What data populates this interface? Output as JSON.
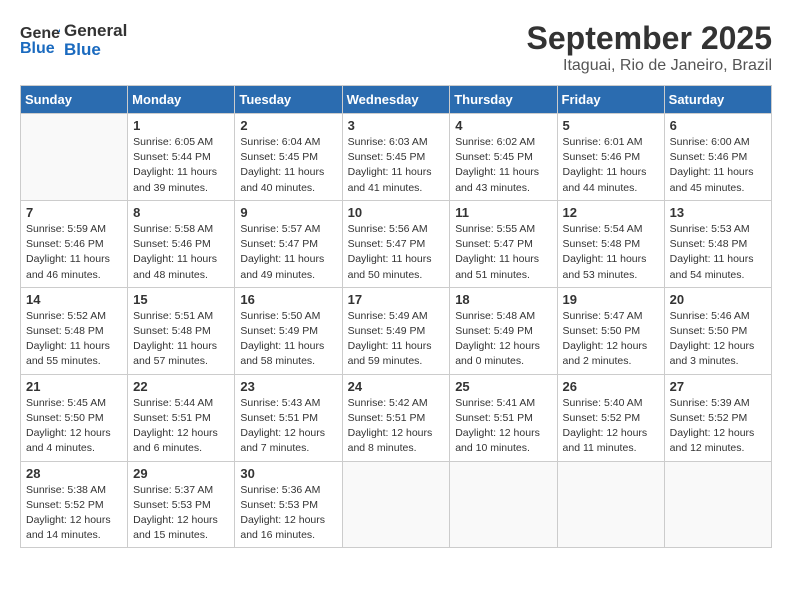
{
  "header": {
    "logo_general": "General",
    "logo_blue": "Blue",
    "title": "September 2025",
    "subtitle": "Itaguai, Rio de Janeiro, Brazil"
  },
  "weekdays": [
    "Sunday",
    "Monday",
    "Tuesday",
    "Wednesday",
    "Thursday",
    "Friday",
    "Saturday"
  ],
  "weeks": [
    [
      {
        "day": "",
        "info": ""
      },
      {
        "day": "1",
        "info": "Sunrise: 6:05 AM\nSunset: 5:44 PM\nDaylight: 11 hours\nand 39 minutes."
      },
      {
        "day": "2",
        "info": "Sunrise: 6:04 AM\nSunset: 5:45 PM\nDaylight: 11 hours\nand 40 minutes."
      },
      {
        "day": "3",
        "info": "Sunrise: 6:03 AM\nSunset: 5:45 PM\nDaylight: 11 hours\nand 41 minutes."
      },
      {
        "day": "4",
        "info": "Sunrise: 6:02 AM\nSunset: 5:45 PM\nDaylight: 11 hours\nand 43 minutes."
      },
      {
        "day": "5",
        "info": "Sunrise: 6:01 AM\nSunset: 5:46 PM\nDaylight: 11 hours\nand 44 minutes."
      },
      {
        "day": "6",
        "info": "Sunrise: 6:00 AM\nSunset: 5:46 PM\nDaylight: 11 hours\nand 45 minutes."
      }
    ],
    [
      {
        "day": "7",
        "info": "Sunrise: 5:59 AM\nSunset: 5:46 PM\nDaylight: 11 hours\nand 46 minutes."
      },
      {
        "day": "8",
        "info": "Sunrise: 5:58 AM\nSunset: 5:46 PM\nDaylight: 11 hours\nand 48 minutes."
      },
      {
        "day": "9",
        "info": "Sunrise: 5:57 AM\nSunset: 5:47 PM\nDaylight: 11 hours\nand 49 minutes."
      },
      {
        "day": "10",
        "info": "Sunrise: 5:56 AM\nSunset: 5:47 PM\nDaylight: 11 hours\nand 50 minutes."
      },
      {
        "day": "11",
        "info": "Sunrise: 5:55 AM\nSunset: 5:47 PM\nDaylight: 11 hours\nand 51 minutes."
      },
      {
        "day": "12",
        "info": "Sunrise: 5:54 AM\nSunset: 5:48 PM\nDaylight: 11 hours\nand 53 minutes."
      },
      {
        "day": "13",
        "info": "Sunrise: 5:53 AM\nSunset: 5:48 PM\nDaylight: 11 hours\nand 54 minutes."
      }
    ],
    [
      {
        "day": "14",
        "info": "Sunrise: 5:52 AM\nSunset: 5:48 PM\nDaylight: 11 hours\nand 55 minutes."
      },
      {
        "day": "15",
        "info": "Sunrise: 5:51 AM\nSunset: 5:48 PM\nDaylight: 11 hours\nand 57 minutes."
      },
      {
        "day": "16",
        "info": "Sunrise: 5:50 AM\nSunset: 5:49 PM\nDaylight: 11 hours\nand 58 minutes."
      },
      {
        "day": "17",
        "info": "Sunrise: 5:49 AM\nSunset: 5:49 PM\nDaylight: 11 hours\nand 59 minutes."
      },
      {
        "day": "18",
        "info": "Sunrise: 5:48 AM\nSunset: 5:49 PM\nDaylight: 12 hours\nand 0 minutes."
      },
      {
        "day": "19",
        "info": "Sunrise: 5:47 AM\nSunset: 5:50 PM\nDaylight: 12 hours\nand 2 minutes."
      },
      {
        "day": "20",
        "info": "Sunrise: 5:46 AM\nSunset: 5:50 PM\nDaylight: 12 hours\nand 3 minutes."
      }
    ],
    [
      {
        "day": "21",
        "info": "Sunrise: 5:45 AM\nSunset: 5:50 PM\nDaylight: 12 hours\nand 4 minutes."
      },
      {
        "day": "22",
        "info": "Sunrise: 5:44 AM\nSunset: 5:51 PM\nDaylight: 12 hours\nand 6 minutes."
      },
      {
        "day": "23",
        "info": "Sunrise: 5:43 AM\nSunset: 5:51 PM\nDaylight: 12 hours\nand 7 minutes."
      },
      {
        "day": "24",
        "info": "Sunrise: 5:42 AM\nSunset: 5:51 PM\nDaylight: 12 hours\nand 8 minutes."
      },
      {
        "day": "25",
        "info": "Sunrise: 5:41 AM\nSunset: 5:51 PM\nDaylight: 12 hours\nand 10 minutes."
      },
      {
        "day": "26",
        "info": "Sunrise: 5:40 AM\nSunset: 5:52 PM\nDaylight: 12 hours\nand 11 minutes."
      },
      {
        "day": "27",
        "info": "Sunrise: 5:39 AM\nSunset: 5:52 PM\nDaylight: 12 hours\nand 12 minutes."
      }
    ],
    [
      {
        "day": "28",
        "info": "Sunrise: 5:38 AM\nSunset: 5:52 PM\nDaylight: 12 hours\nand 14 minutes."
      },
      {
        "day": "29",
        "info": "Sunrise: 5:37 AM\nSunset: 5:53 PM\nDaylight: 12 hours\nand 15 minutes."
      },
      {
        "day": "30",
        "info": "Sunrise: 5:36 AM\nSunset: 5:53 PM\nDaylight: 12 hours\nand 16 minutes."
      },
      {
        "day": "",
        "info": ""
      },
      {
        "day": "",
        "info": ""
      },
      {
        "day": "",
        "info": ""
      },
      {
        "day": "",
        "info": ""
      }
    ]
  ]
}
